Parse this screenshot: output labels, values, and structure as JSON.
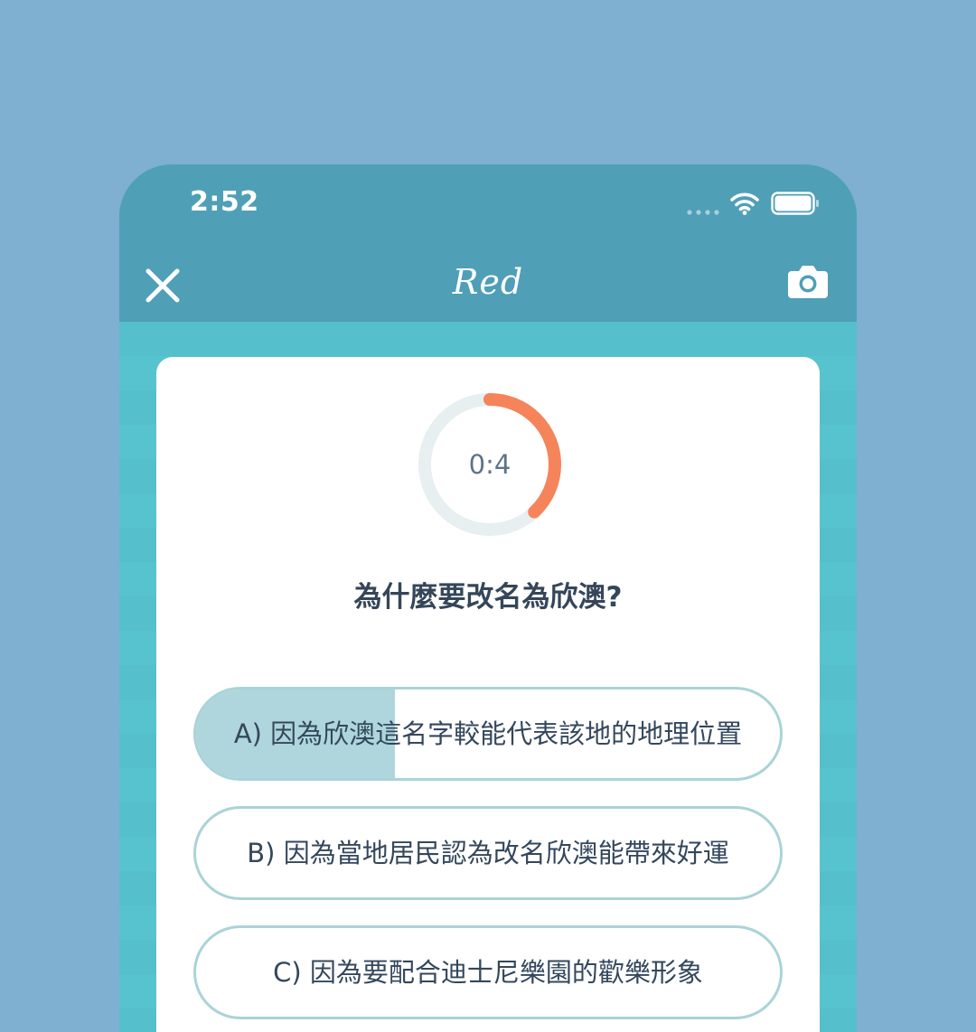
{
  "status_bar": {
    "time": "2:52"
  },
  "header": {
    "title": "Red",
    "close_icon": "close-icon",
    "camera_icon": "camera-icon"
  },
  "quiz": {
    "timer_text": "0:4",
    "timer_progress": 0.38,
    "question": "為什麼要改名為欣澳?",
    "options": [
      {
        "label": "A) 因為欣澳這名字較能代表該地的地理位置",
        "highlight_fraction": 0.34
      },
      {
        "label": "B) 因為當地居民認為改名欣澳能帶來好運"
      },
      {
        "label": "C) 因為要配合迪士尼樂園的歡樂形象"
      }
    ]
  },
  "colors": {
    "background": "#7fafd1",
    "header": "#4f9fb7",
    "content": "#55bfcb",
    "timer_accent": "#f5845a",
    "timer_track": "#e7eff0",
    "option_border": "#aad3d8",
    "option_highlight": "#aed6dc",
    "text": "#35465a"
  }
}
